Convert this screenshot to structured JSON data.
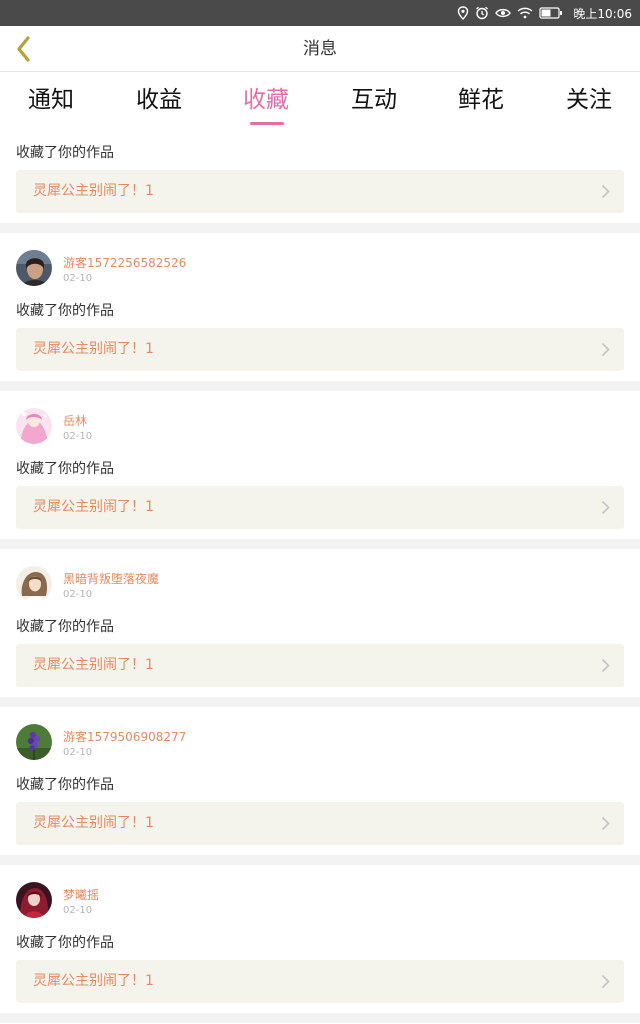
{
  "status_bar": {
    "time": "晚上10:06"
  },
  "header": {
    "title": "消息"
  },
  "tabs": [
    {
      "label": "通知"
    },
    {
      "label": "收益"
    },
    {
      "label": "收藏"
    },
    {
      "label": "互动"
    },
    {
      "label": "鲜花"
    },
    {
      "label": "关注"
    }
  ],
  "active_tab": "收藏",
  "colors": {
    "accent": "#e36fa8",
    "name_and_work": "#e58a61",
    "work_bg": "#f4f3ec",
    "separator": "#f3f3f3"
  },
  "feed": {
    "partial_item": {
      "action": "收藏了你的作品",
      "work_title": "灵犀公主别闹了！1"
    },
    "items": [
      {
        "user": "游客1572256582526",
        "date": "02-10",
        "action": "收藏了你的作品",
        "work_title": "灵犀公主别闹了！1",
        "avatar_icon": "portrait-avatar"
      },
      {
        "user": "岳林",
        "date": "02-10",
        "action": "收藏了你的作品",
        "work_title": "灵犀公主别闹了！1",
        "avatar_icon": "pink-anime-avatar"
      },
      {
        "user": "黑暗背叛堕落夜魔",
        "date": "02-10",
        "action": "收藏了你的作品",
        "work_title": "灵犀公主别闹了！1",
        "avatar_icon": "sketch-anime-avatar"
      },
      {
        "user": "游客1579506908277",
        "date": "02-10",
        "action": "收藏了你的作品",
        "work_title": "灵犀公主别闹了！1",
        "avatar_icon": "purple-flower-avatar"
      },
      {
        "user": "梦曦摇",
        "date": "02-10",
        "action": "收藏了你的作品",
        "work_title": "灵犀公主别闹了！1",
        "avatar_icon": "red-anime-avatar"
      }
    ]
  }
}
